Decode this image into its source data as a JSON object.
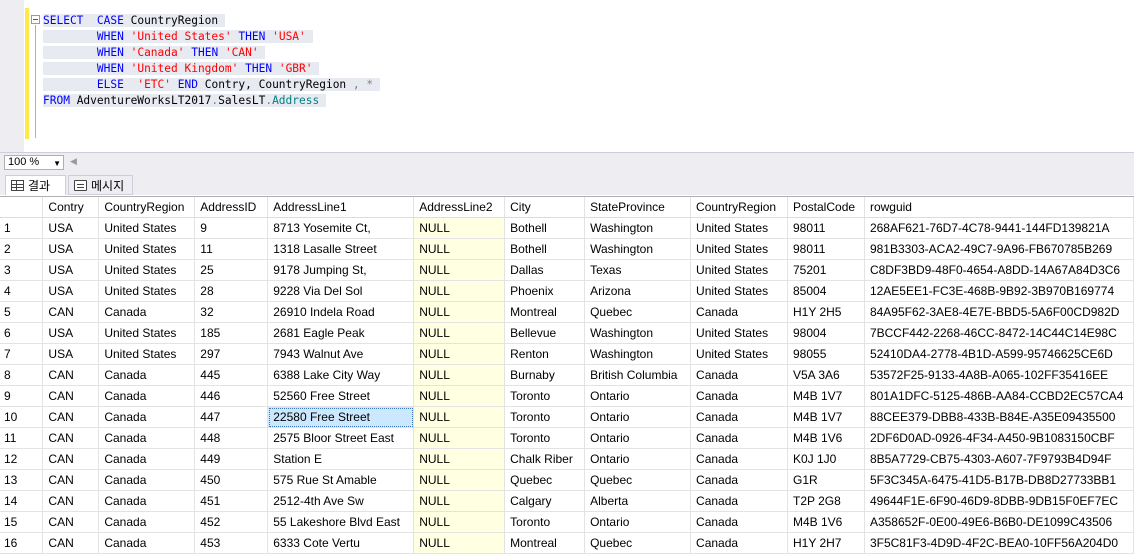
{
  "editor": {
    "lines": [
      [
        {
          "t": "SELECT",
          "c": "kw"
        },
        {
          "t": "  ",
          "c": ""
        },
        {
          "t": "CASE",
          "c": "kw"
        },
        {
          "t": " CountryRegion ",
          "c": ""
        }
      ],
      [
        {
          "t": "        ",
          "c": ""
        },
        {
          "t": "WHEN",
          "c": "kw"
        },
        {
          "t": " ",
          "c": ""
        },
        {
          "t": "'United States'",
          "c": "str"
        },
        {
          "t": " ",
          "c": ""
        },
        {
          "t": "THEN",
          "c": "kw"
        },
        {
          "t": " ",
          "c": ""
        },
        {
          "t": "'USA'",
          "c": "str"
        },
        {
          "t": " ",
          "c": ""
        }
      ],
      [
        {
          "t": "        ",
          "c": ""
        },
        {
          "t": "WHEN",
          "c": "kw"
        },
        {
          "t": " ",
          "c": ""
        },
        {
          "t": "'Canada'",
          "c": "str"
        },
        {
          "t": " ",
          "c": ""
        },
        {
          "t": "THEN",
          "c": "kw"
        },
        {
          "t": " ",
          "c": ""
        },
        {
          "t": "'CAN'",
          "c": "str"
        },
        {
          "t": " ",
          "c": ""
        }
      ],
      [
        {
          "t": "        ",
          "c": ""
        },
        {
          "t": "WHEN",
          "c": "kw"
        },
        {
          "t": " ",
          "c": ""
        },
        {
          "t": "'United Kingdom'",
          "c": "str"
        },
        {
          "t": " ",
          "c": ""
        },
        {
          "t": "THEN",
          "c": "kw"
        },
        {
          "t": " ",
          "c": ""
        },
        {
          "t": "'GBR'",
          "c": "str"
        },
        {
          "t": " ",
          "c": ""
        }
      ],
      [
        {
          "t": "        ",
          "c": ""
        },
        {
          "t": "ELSE",
          "c": "kw"
        },
        {
          "t": "  ",
          "c": ""
        },
        {
          "t": "'ETC'",
          "c": "str"
        },
        {
          "t": " ",
          "c": ""
        },
        {
          "t": "END",
          "c": "kw"
        },
        {
          "t": " Contry, CountryRegion ",
          "c": ""
        },
        {
          "t": ",",
          "c": "gray"
        },
        {
          "t": " ",
          "c": ""
        },
        {
          "t": "*",
          "c": "gray"
        },
        {
          "t": " ",
          "c": ""
        }
      ],
      [
        {
          "t": "FROM",
          "c": "kw"
        },
        {
          "t": " AdventureWorksLT2017",
          "c": ""
        },
        {
          "t": ".",
          "c": "gray"
        },
        {
          "t": "SalesLT",
          "c": ""
        },
        {
          "t": ".",
          "c": "gray"
        },
        {
          "t": "Address",
          "c": "grn"
        },
        {
          "t": " ",
          "c": ""
        }
      ]
    ]
  },
  "zoom": {
    "value": "100 %"
  },
  "tabs": {
    "results": "결과",
    "messages": "메시지"
  },
  "grid": {
    "columns": [
      "Contry",
      "CountryRegion",
      "AddressID",
      "AddressLine1",
      "AddressLine2",
      "City",
      "StateProvince",
      "CountryRegion",
      "PostalCode",
      "rowguid"
    ],
    "rows": [
      [
        "1",
        "USA",
        "United States",
        "9",
        "8713 Yosemite Ct,",
        "NULL",
        "Bothell",
        "Washington",
        "United States",
        "98011",
        "268AF621-76D7-4C78-9441-144FD139821A"
      ],
      [
        "2",
        "USA",
        "United States",
        "11",
        "1318 Lasalle Street",
        "NULL",
        "Bothell",
        "Washington",
        "United States",
        "98011",
        "981B3303-ACA2-49C7-9A96-FB670785B269"
      ],
      [
        "3",
        "USA",
        "United States",
        "25",
        "9178 Jumping St,",
        "NULL",
        "Dallas",
        "Texas",
        "United States",
        "75201",
        "C8DF3BD9-48F0-4654-A8DD-14A67A84D3C6"
      ],
      [
        "4",
        "USA",
        "United States",
        "28",
        "9228 Via Del Sol",
        "NULL",
        "Phoenix",
        "Arizona",
        "United States",
        "85004",
        "12AE5EE1-FC3E-468B-9B92-3B970B169774"
      ],
      [
        "5",
        "CAN",
        "Canada",
        "32",
        "26910 Indela Road",
        "NULL",
        "Montreal",
        "Quebec",
        "Canada",
        "H1Y 2H5",
        "84A95F62-3AE8-4E7E-BBD5-5A6F00CD982D"
      ],
      [
        "6",
        "USA",
        "United States",
        "185",
        "2681 Eagle Peak",
        "NULL",
        "Bellevue",
        "Washington",
        "United States",
        "98004",
        "7BCCF442-2268-46CC-8472-14C44C14E98C"
      ],
      [
        "7",
        "USA",
        "United States",
        "297",
        "7943 Walnut Ave",
        "NULL",
        "Renton",
        "Washington",
        "United States",
        "98055",
        "52410DA4-2778-4B1D-A599-95746625CE6D"
      ],
      [
        "8",
        "CAN",
        "Canada",
        "445",
        "6388 Lake City Way",
        "NULL",
        "Burnaby",
        "British Columbia",
        "Canada",
        "V5A 3A6",
        "53572F25-9133-4A8B-A065-102FF35416EE"
      ],
      [
        "9",
        "CAN",
        "Canada",
        "446",
        "52560 Free Street",
        "NULL",
        "Toronto",
        "Ontario",
        "Canada",
        "M4B 1V7",
        "801A1DFC-5125-486B-AA84-CCBD2EC57CA4"
      ],
      [
        "10",
        "CAN",
        "Canada",
        "447",
        "22580 Free Street",
        "NULL",
        "Toronto",
        "Ontario",
        "Canada",
        "M4B 1V7",
        "88CEE379-DBB8-433B-B84E-A35E09435500"
      ],
      [
        "11",
        "CAN",
        "Canada",
        "448",
        "2575 Bloor Street East",
        "NULL",
        "Toronto",
        "Ontario",
        "Canada",
        "M4B 1V6",
        "2DF6D0AD-0926-4F34-A450-9B1083150CBF"
      ],
      [
        "12",
        "CAN",
        "Canada",
        "449",
        "Station E",
        "NULL",
        "Chalk Riber",
        "Ontario",
        "Canada",
        "K0J 1J0",
        "8B5A7729-CB75-4303-A607-7F9793B4D94F"
      ],
      [
        "13",
        "CAN",
        "Canada",
        "450",
        "575 Rue St Amable",
        "NULL",
        "Quebec",
        "Quebec",
        "Canada",
        "G1R",
        "5F3C345A-6475-41D5-B17B-DB8D27733BB1"
      ],
      [
        "14",
        "CAN",
        "Canada",
        "451",
        "2512-4th Ave Sw",
        "NULL",
        "Calgary",
        "Alberta",
        "Canada",
        "T2P 2G8",
        "49644F1E-6F90-46D9-8DBB-9DB15F0EF7EC"
      ],
      [
        "15",
        "CAN",
        "Canada",
        "452",
        "55 Lakeshore Blvd East",
        "NULL",
        "Toronto",
        "Ontario",
        "Canada",
        "M4B 1V6",
        "A358652F-0E00-49E6-B6B0-DE1099C43506"
      ],
      [
        "16",
        "CAN",
        "Canada",
        "453",
        "6333 Cote Vertu",
        "NULL",
        "Montreal",
        "Quebec",
        "Canada",
        "H1Y 2H7",
        "3F5C81F3-4D9D-4F2C-BEA0-10FF56A204D0"
      ]
    ],
    "selected_cell": {
      "row": 9,
      "col": 4
    }
  }
}
